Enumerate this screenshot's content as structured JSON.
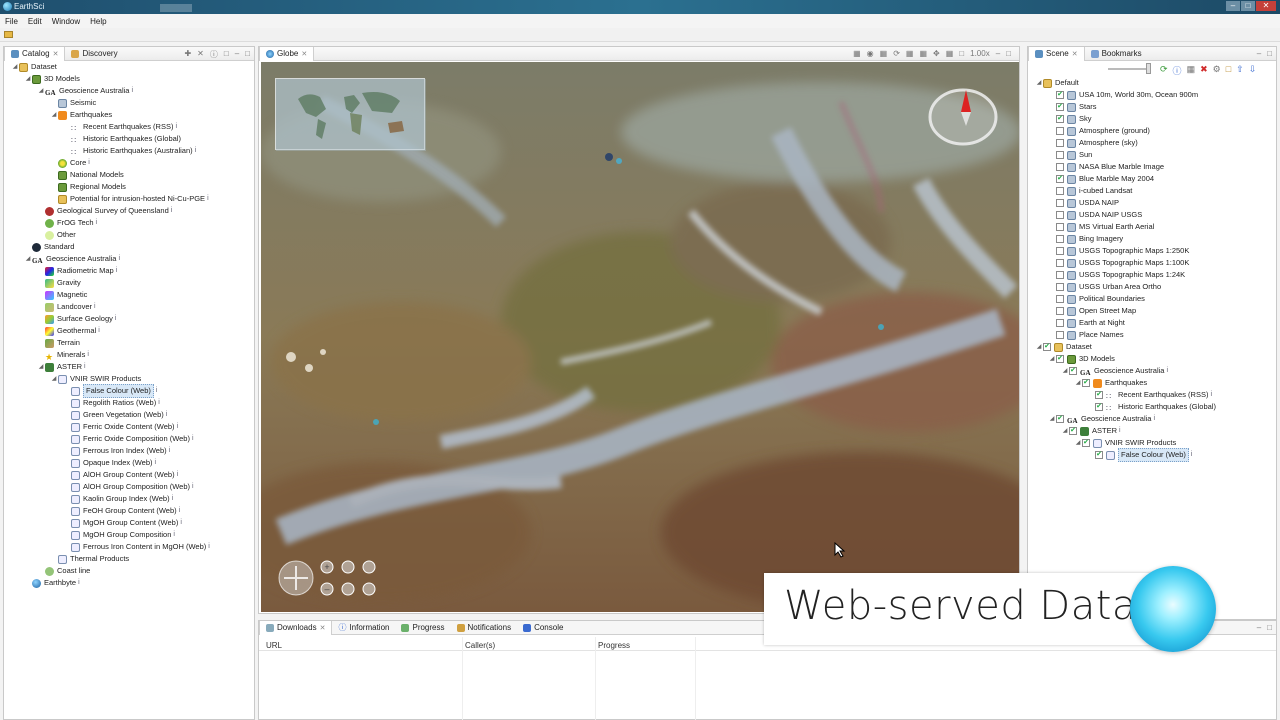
{
  "window": {
    "title": "EarthSci"
  },
  "menu": [
    "File",
    "Edit",
    "Window",
    "Help"
  ],
  "left_tabs": [
    {
      "label": "Catalog"
    },
    {
      "label": "Discovery"
    }
  ],
  "catalog_tree": [
    {
      "label": "Dataset",
      "depth": 0,
      "icon": "folder-icon",
      "expanded": true
    },
    {
      "label": "3D Models",
      "depth": 1,
      "icon": "model-icon",
      "expanded": true
    },
    {
      "label": "Geoscience Australia",
      "depth": 2,
      "icon": "ga-icon",
      "expanded": true,
      "info": true
    },
    {
      "label": "Seismic",
      "depth": 3,
      "icon": "layer-icon"
    },
    {
      "label": "Earthquakes",
      "depth": 3,
      "icon": "rss-icon",
      "expanded": true
    },
    {
      "label": "Recent Earthquakes (RSS)",
      "depth": 4,
      "icon": "quake-icon",
      "info": true
    },
    {
      "label": "Historic Earthquakes (Global)",
      "depth": 4,
      "icon": "quake-icon"
    },
    {
      "label": "Historic Earthquakes (Australian)",
      "depth": 4,
      "icon": "quake-icon",
      "info": true
    },
    {
      "label": "Core",
      "depth": 3,
      "icon": "core-icon",
      "info": true
    },
    {
      "label": "National Models",
      "depth": 3,
      "icon": "model-icon"
    },
    {
      "label": "Regional Models",
      "depth": 3,
      "icon": "model-icon"
    },
    {
      "label": "Potential for intrusion-hosted Ni-Cu-PGE",
      "depth": 3,
      "icon": "folder-icon",
      "info": true
    },
    {
      "label": "Geological Survey of Queensland",
      "depth": 2,
      "icon": "red-icon",
      "info": true
    },
    {
      "label": "FrOG Tech",
      "depth": 2,
      "icon": "green-icon",
      "info": true
    },
    {
      "label": "Other",
      "depth": 2,
      "icon": "cloud-icon"
    },
    {
      "label": "Standard",
      "depth": 1,
      "icon": "dark-globe-icon"
    },
    {
      "label": "Geoscience Australia",
      "depth": 1,
      "icon": "ga-icon",
      "expanded": true,
      "info": true
    },
    {
      "label": "Radiometric Map",
      "depth": 2,
      "icon": "radiometric-icon",
      "info": true
    },
    {
      "label": "Gravity",
      "depth": 2,
      "icon": "gravity-icon"
    },
    {
      "label": "Magnetic",
      "depth": 2,
      "icon": "magnetic-icon"
    },
    {
      "label": "Landcover",
      "depth": 2,
      "icon": "landcover-icon",
      "info": true
    },
    {
      "label": "Surface Geology",
      "depth": 2,
      "icon": "surface-geology-icon",
      "info": true
    },
    {
      "label": "Geothermal",
      "depth": 2,
      "icon": "geothermal-icon",
      "info": true
    },
    {
      "label": "Terrain",
      "depth": 2,
      "icon": "terrain-icon"
    },
    {
      "label": "Minerals",
      "depth": 2,
      "icon": "star-icon",
      "info": true
    },
    {
      "label": "ASTER",
      "depth": 2,
      "icon": "aster-icon",
      "expanded": true,
      "info": true
    },
    {
      "label": "VNIR SWIR Products",
      "depth": 3,
      "icon": "sub-icon",
      "expanded": true
    },
    {
      "label": "False Colour (Web)",
      "depth": 4,
      "icon": "sub-icon",
      "info": true,
      "selected": true
    },
    {
      "label": "Regolith Ratios (Web)",
      "depth": 4,
      "icon": "sub-icon",
      "info": true
    },
    {
      "label": "Green Vegetation (Web)",
      "depth": 4,
      "icon": "sub-icon",
      "info": true
    },
    {
      "label": "Ferric Oxide Content (Web)",
      "depth": 4,
      "icon": "sub-icon",
      "info": true
    },
    {
      "label": "Ferric Oxide Composition (Web)",
      "depth": 4,
      "icon": "sub-icon",
      "info": true
    },
    {
      "label": "Ferrous Iron Index (Web)",
      "depth": 4,
      "icon": "sub-icon",
      "info": true
    },
    {
      "label": "Opaque Index (Web)",
      "depth": 4,
      "icon": "sub-icon",
      "info": true
    },
    {
      "label": "AlOH Group Content (Web)",
      "depth": 4,
      "icon": "sub-icon",
      "info": true
    },
    {
      "label": "AlOH Group Composition (Web)",
      "depth": 4,
      "icon": "sub-icon",
      "info": true
    },
    {
      "label": "Kaolin Group Index (Web)",
      "depth": 4,
      "icon": "sub-icon",
      "info": true
    },
    {
      "label": "FeOH Group Content (Web)",
      "depth": 4,
      "icon": "sub-icon",
      "info": true
    },
    {
      "label": "MgOH Group Content (Web)",
      "depth": 4,
      "icon": "sub-icon",
      "info": true
    },
    {
      "label": "MgOH Group Composition",
      "depth": 4,
      "icon": "sub-icon",
      "info": true
    },
    {
      "label": "Ferrous Iron Content in MgOH (Web)",
      "depth": 4,
      "icon": "sub-icon",
      "info": true
    },
    {
      "label": "Thermal Products",
      "depth": 3,
      "icon": "sub-icon"
    },
    {
      "label": "Coast line",
      "depth": 2,
      "icon": "coast-icon"
    },
    {
      "label": "Earthbyte",
      "depth": 1,
      "icon": "globe-icon",
      "info": true
    }
  ],
  "globe": {
    "tab": "Globe",
    "zoom": "1.00x"
  },
  "right_tabs": [
    {
      "label": "Scene"
    },
    {
      "label": "Bookmarks"
    }
  ],
  "scene_tree": [
    {
      "label": "Default",
      "depth": 0,
      "icon": "folder-icon",
      "expanded": true,
      "checkbox": false
    },
    {
      "label": "USA 10m, World 30m, Ocean 900m",
      "depth": 1,
      "checked": true
    },
    {
      "label": "Stars",
      "depth": 1,
      "checked": true
    },
    {
      "label": "Sky",
      "depth": 1,
      "checked": true
    },
    {
      "label": "Atmosphere (ground)",
      "depth": 1,
      "checked": false
    },
    {
      "label": "Atmosphere (sky)",
      "depth": 1,
      "checked": false
    },
    {
      "label": "Sun",
      "depth": 1,
      "checked": false
    },
    {
      "label": "NASA Blue Marble Image",
      "depth": 1,
      "checked": false
    },
    {
      "label": "Blue Marble May 2004",
      "depth": 1,
      "checked": true
    },
    {
      "label": "i-cubed Landsat",
      "depth": 1,
      "checked": false
    },
    {
      "label": "USDA NAIP",
      "depth": 1,
      "checked": false
    },
    {
      "label": "USDA NAIP USGS",
      "depth": 1,
      "checked": false
    },
    {
      "label": "MS Virtual Earth Aerial",
      "depth": 1,
      "checked": false
    },
    {
      "label": "Bing Imagery",
      "depth": 1,
      "checked": false
    },
    {
      "label": "USGS Topographic Maps 1:250K",
      "depth": 1,
      "checked": false
    },
    {
      "label": "USGS Topographic Maps 1:100K",
      "depth": 1,
      "checked": false
    },
    {
      "label": "USGS Topographic Maps 1:24K",
      "depth": 1,
      "checked": false
    },
    {
      "label": "USGS Urban Area Ortho",
      "depth": 1,
      "checked": false
    },
    {
      "label": "Political Boundaries",
      "depth": 1,
      "checked": false
    },
    {
      "label": "Open Street Map",
      "depth": 1,
      "checked": false
    },
    {
      "label": "Earth at Night",
      "depth": 1,
      "checked": false
    },
    {
      "label": "Place Names",
      "depth": 1,
      "checked": false
    },
    {
      "label": "Dataset",
      "depth": 0,
      "icon": "folder-icon",
      "expanded": true,
      "checked": true
    },
    {
      "label": "3D Models",
      "depth": 1,
      "icon": "model-icon",
      "expanded": true,
      "checked": true
    },
    {
      "label": "Geoscience Australia",
      "depth": 2,
      "icon": "ga-icon",
      "expanded": true,
      "checked": true,
      "info": true
    },
    {
      "label": "Earthquakes",
      "depth": 3,
      "icon": "rss-icon",
      "expanded": true,
      "checked": true
    },
    {
      "label": "Recent Earthquakes (RSS)",
      "depth": 4,
      "icon": "quake-icon",
      "checked": true,
      "info": true
    },
    {
      "label": "Historic Earthquakes (Global)",
      "depth": 4,
      "icon": "quake-icon",
      "checked": true
    },
    {
      "label": "Geoscience Australia",
      "depth": 1,
      "icon": "ga-icon",
      "expanded": true,
      "checked": true,
      "info": true
    },
    {
      "label": "ASTER",
      "depth": 2,
      "icon": "aster-icon",
      "expanded": true,
      "checked": true,
      "info": true
    },
    {
      "label": "VNIR SWIR Products",
      "depth": 3,
      "icon": "sub-icon",
      "expanded": true,
      "checked": true
    },
    {
      "label": "False Colour (Web)",
      "depth": 4,
      "icon": "sub-icon",
      "checked": true,
      "info": true,
      "selected": true
    }
  ],
  "bottom_tabs": [
    {
      "label": "Downloads"
    },
    {
      "label": "Information"
    },
    {
      "label": "Progress"
    },
    {
      "label": "Notifications"
    },
    {
      "label": "Console"
    }
  ],
  "downloads_columns": [
    "URL",
    "Caller(s)",
    "Progress"
  ],
  "overlay": {
    "caption": "Web-served Data"
  },
  "colors": {
    "titlebar": "#2b7090",
    "selection": "#d8e8f7",
    "overlay_bubble": "#38c9ef"
  }
}
